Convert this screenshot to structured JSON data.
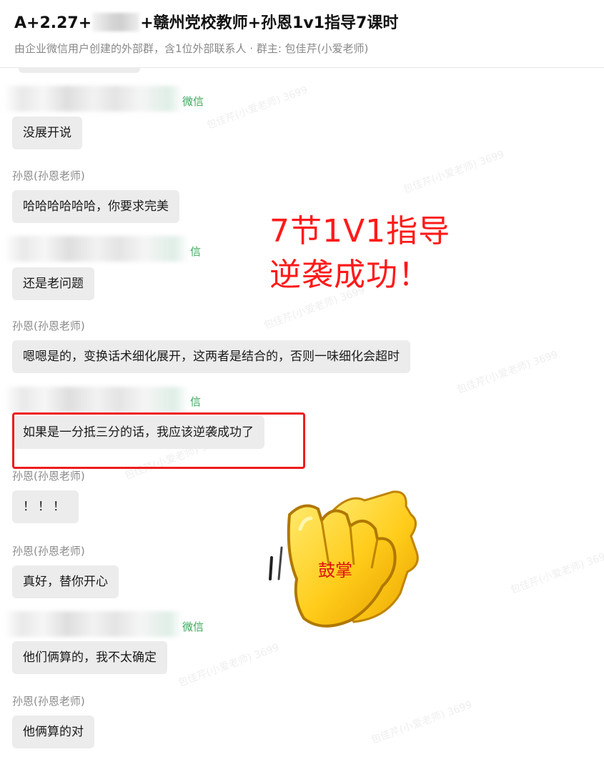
{
  "header": {
    "title_prefix": "A+2.27+",
    "title_suffix": "+赣州党校教师+孙恩1v1指导7课时",
    "subtitle": "由企业微信用户创建的外部群，含1位外部联系人 · 群主: 包佳芹(小爱老师)"
  },
  "messages": [
    {
      "sender_suffix": "微信",
      "text": "没展开说"
    },
    {
      "sender": "孙恩(孙恩老师)",
      "text": "哈哈哈哈哈哈，你要求完美"
    },
    {
      "sender_suffix": "信",
      "text": "还是老问题"
    },
    {
      "sender": "孙恩(孙恩老师)",
      "text": "嗯嗯是的，变换话术细化展开，这两者是结合的，否则一味细化会超时"
    },
    {
      "sender_suffix": "信",
      "text": "如果是一分抵三分的话，我应该逆袭成功了"
    },
    {
      "sender": "孙恩(孙恩老师)",
      "text": "！！！"
    },
    {
      "sender": "孙恩(孙恩老师)",
      "text": "真好，替你开心"
    },
    {
      "sender_suffix": "微信",
      "text": "他们俩算的，我不太确定"
    },
    {
      "sender": "孙恩(孙恩老师)",
      "text": "他俩算的对"
    }
  ],
  "annotation": {
    "line1": "7节1V1指导",
    "line2": "逆袭成功！",
    "sticker_text": "鼓掌",
    "color": "#ff1a1a"
  },
  "watermark": "包佳芹(小爱老师) 3699"
}
